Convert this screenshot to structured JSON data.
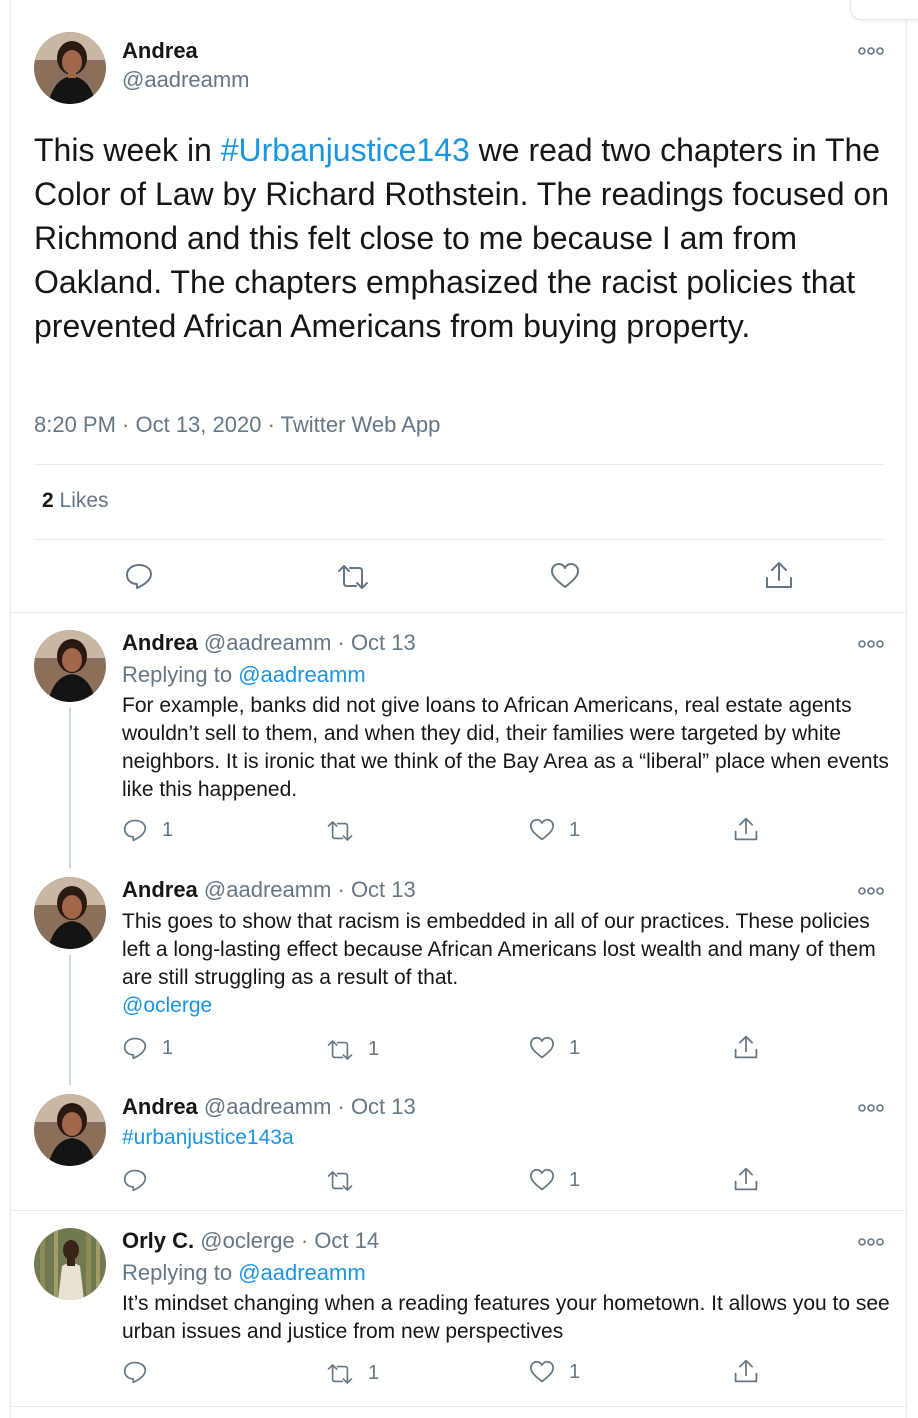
{
  "main_tweet": {
    "name": "Andrea",
    "handle": "@aadreamm",
    "text_hashtag": "#Urbanjustice143",
    "text_rest": " we read two chapters in The Color of Law by Richard Rothstein. The readings focused on Richmond and this felt close to me because I am from Oakland. The chapters emphasized the racist policies that prevented African Americans from buying property.",
    "text_prefix": "This week in ",
    "meta": "8:20 PM · Oct 13, 2020 · Twitter Web App",
    "likes_count": "2",
    "likes_label": " Likes"
  },
  "replies": [
    {
      "name": "Andrea",
      "handle_date": " @aadreamm · Oct 13",
      "replying_prefix": "Replying to ",
      "replying_handle": "@aadreamm",
      "text": "For example, banks did not give loans to African Americans, real estate agents wouldn’t sell to them, and when they did, their families were targeted by white neighbors. It is ironic that we think of the Bay Area as a  “liberal” place when events like this happened.",
      "reply_count": "1",
      "retweet_count": "",
      "like_count": "1"
    },
    {
      "name": "Andrea",
      "handle_date": " @aadreamm · Oct 13",
      "text": "This goes to show that racism is embedded in all of our practices. These policies left a long-lasting effect because African Americans lost wealth and many of them are still struggling as a result of that.",
      "mention": "@oclerge",
      "reply_count": "1",
      "retweet_count": "1",
      "like_count": "1"
    },
    {
      "name": "Andrea",
      "handle_date": " @aadreamm · Oct 13",
      "hashtag": "#urbanjustice143a",
      "reply_count": "",
      "retweet_count": "",
      "like_count": "1"
    },
    {
      "name": "Orly C.",
      "handle_date": " @oclerge · Oct 14",
      "replying_prefix": "Replying to ",
      "replying_handle": "@aadreamm",
      "text": "It’s mindset changing when a reading features your hometown. It allows you to see urban issues and justice from new perspectives",
      "reply_count": "",
      "retweet_count": "1",
      "like_count": "1"
    }
  ],
  "colors": {
    "link": "#1b95e0",
    "secondary_text": "#657786",
    "primary_text": "#14171a",
    "divider": "#e6ecf0"
  },
  "icons": [
    "reply-icon",
    "retweet-icon",
    "like-icon",
    "share-icon",
    "more-icon",
    "avatar"
  ]
}
